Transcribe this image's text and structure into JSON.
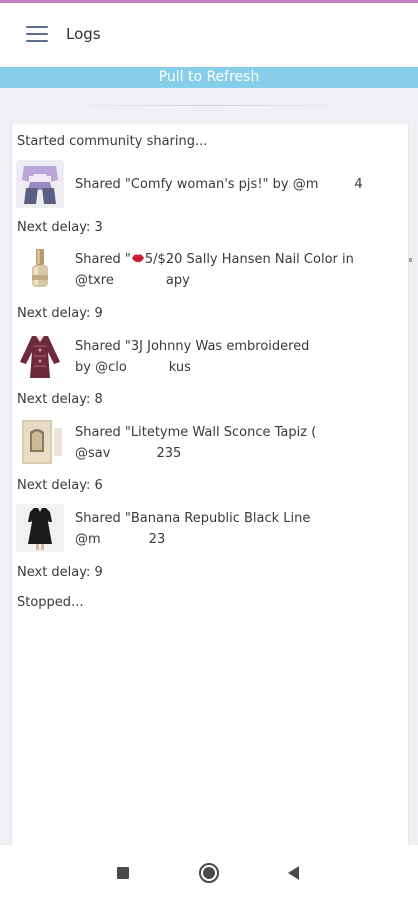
{
  "header": {
    "menu_icon": "hamburger-menu-icon",
    "title": "Logs"
  },
  "refresh_bar": {
    "label": "Pull to Refresh"
  },
  "log": {
    "start_message": "Started community sharing...",
    "entries": [
      {
        "thumbnail": "pajama-product-photo",
        "line1": "Shared \"Comfy woman's pjs!\" by @m",
        "line1_tail": "4",
        "line2": "",
        "line2_tail": "",
        "delay": "Next delay: 3"
      },
      {
        "thumbnail": "nail-polish-product-photo",
        "line1": "Shared \"",
        "line1_tail": "5/$20 Sally Hansen Nail Color in",
        "line2": "@txre",
        "line2_tail": "apy",
        "delay": "Next delay: 9"
      },
      {
        "thumbnail": "embroidered-tunic-product-photo",
        "line1": "Shared \"3J Johnny Was embroidered",
        "line1_tail": "",
        "line2": "by @clo",
        "line2_tail": "kus",
        "delay": "Next delay: 8"
      },
      {
        "thumbnail": "wall-sconce-product-photo",
        "line1": "Shared \"Litetyme Wall Sconce Tapiz (",
        "line1_tail": "",
        "line2": "@sav",
        "line2_tail": "235",
        "delay": "Next delay: 6"
      },
      {
        "thumbnail": "black-dress-product-photo",
        "line1": "Shared \"Banana Republic Black Line",
        "line1_tail": "",
        "line2": "@m",
        "line2_tail": "23",
        "delay": "Next delay: 9"
      }
    ],
    "stop_message": "Stopped..."
  },
  "nav": {
    "recents_icon": "square-recents-icon",
    "home_icon": "circle-home-icon",
    "back_icon": "triangle-back-icon"
  },
  "colors": {
    "accent_top": "#c27fc2",
    "refresh_bar": "#87ceeb",
    "background": "#eef0f3"
  }
}
